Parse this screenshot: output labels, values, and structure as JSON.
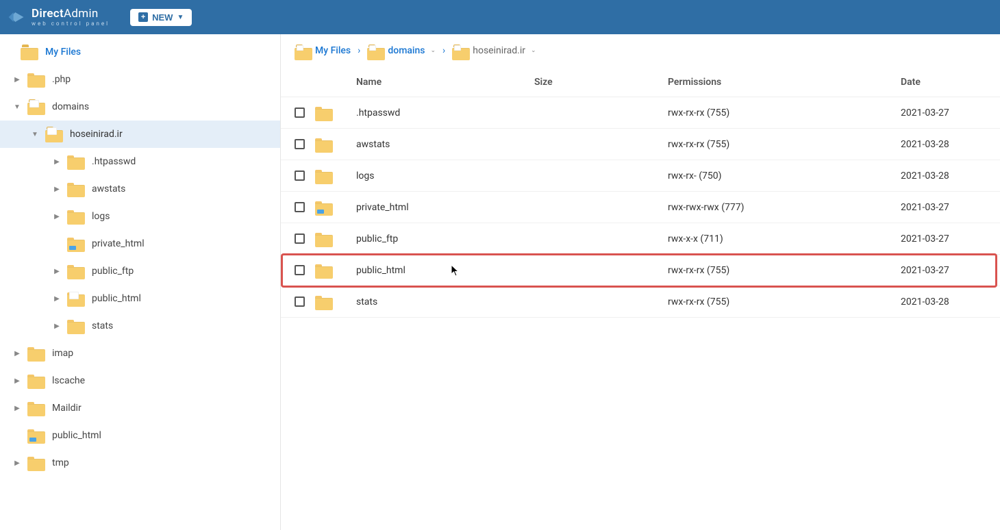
{
  "header": {
    "brand_primary": "Direct",
    "brand_secondary": "Admin",
    "brand_sub": "web control panel",
    "new_button": "NEW"
  },
  "tree": {
    "root": "My Files",
    "items": [
      {
        "label": ".php",
        "level": 1,
        "caret": "right",
        "type": "folder"
      },
      {
        "label": "domains",
        "level": 1,
        "caret": "down",
        "type": "folder-open"
      },
      {
        "label": "hoseinirad.ir",
        "level": 2,
        "caret": "down",
        "type": "folder-open",
        "selected": true
      },
      {
        "label": ".htpasswd",
        "level": 3,
        "caret": "right",
        "type": "folder"
      },
      {
        "label": "awstats",
        "level": 3,
        "caret": "right",
        "type": "folder"
      },
      {
        "label": "logs",
        "level": 3,
        "caret": "right",
        "type": "folder"
      },
      {
        "label": "private_html",
        "level": 3,
        "caret": "none",
        "type": "folder-link"
      },
      {
        "label": "public_ftp",
        "level": 3,
        "caret": "right",
        "type": "folder"
      },
      {
        "label": "public_html",
        "level": 3,
        "caret": "right",
        "type": "folder-doc"
      },
      {
        "label": "stats",
        "level": 3,
        "caret": "right",
        "type": "folder"
      },
      {
        "label": "imap",
        "level": 1,
        "caret": "right",
        "type": "folder"
      },
      {
        "label": "lscache",
        "level": 1,
        "caret": "right",
        "type": "folder"
      },
      {
        "label": "Maildir",
        "level": 1,
        "caret": "right",
        "type": "folder"
      },
      {
        "label": "public_html",
        "level": 1,
        "caret": "none",
        "type": "folder-link"
      },
      {
        "label": "tmp",
        "level": 1,
        "caret": "right",
        "type": "folder"
      }
    ]
  },
  "breadcrumb": [
    {
      "label": "My Files",
      "dropdown": false
    },
    {
      "label": "domains",
      "dropdown": true
    },
    {
      "label": "hoseinirad.ir",
      "dropdown": true,
      "current": true
    }
  ],
  "columns": {
    "name": "Name",
    "size": "Size",
    "permissions": "Permissions",
    "date": "Date"
  },
  "rows": [
    {
      "name": ".htpasswd",
      "size": "",
      "permissions": "rwx-rx-rx (755)",
      "date": "2021-03-27",
      "type": "folder"
    },
    {
      "name": "awstats",
      "size": "",
      "permissions": "rwx-rx-rx (755)",
      "date": "2021-03-28",
      "type": "folder"
    },
    {
      "name": "logs",
      "size": "",
      "permissions": "rwx-rx- (750)",
      "date": "2021-03-28",
      "type": "folder"
    },
    {
      "name": "private_html",
      "size": "",
      "permissions": "rwx-rwx-rwx (777)",
      "date": "2021-03-27",
      "type": "folder-link"
    },
    {
      "name": "public_ftp",
      "size": "",
      "permissions": "rwx-x-x (711)",
      "date": "2021-03-27",
      "type": "folder"
    },
    {
      "name": "public_html",
      "size": "",
      "permissions": "rwx-rx-rx (755)",
      "date": "2021-03-27",
      "type": "folder",
      "highlighted": true
    },
    {
      "name": "stats",
      "size": "",
      "permissions": "rwx-rx-rx (755)",
      "date": "2021-03-28",
      "type": "folder"
    }
  ]
}
